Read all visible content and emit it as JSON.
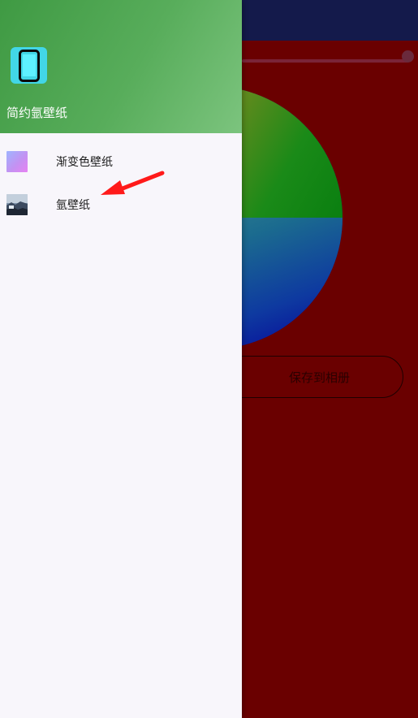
{
  "background_screen": {
    "save_button_label": "保存到相册"
  },
  "drawer": {
    "header": {
      "app_name": "简约氩壁纸",
      "icon": "phone-icon"
    },
    "items": [
      {
        "label": "渐变色壁纸",
        "icon": "gradient-thumbnail"
      },
      {
        "label": "氩壁纸",
        "icon": "photo-thumbnail"
      }
    ]
  },
  "annotation": {
    "type": "red-arrow",
    "points_to": "氩壁纸"
  },
  "colors": {
    "background_red": "#6a0000",
    "top_bar": "#141a4b",
    "drawer_header_green": "#58ad5b",
    "drawer_body": "#f8f6fb",
    "app_icon_cyan": "#42d6e7",
    "arrow_red": "#ff1a1a"
  }
}
